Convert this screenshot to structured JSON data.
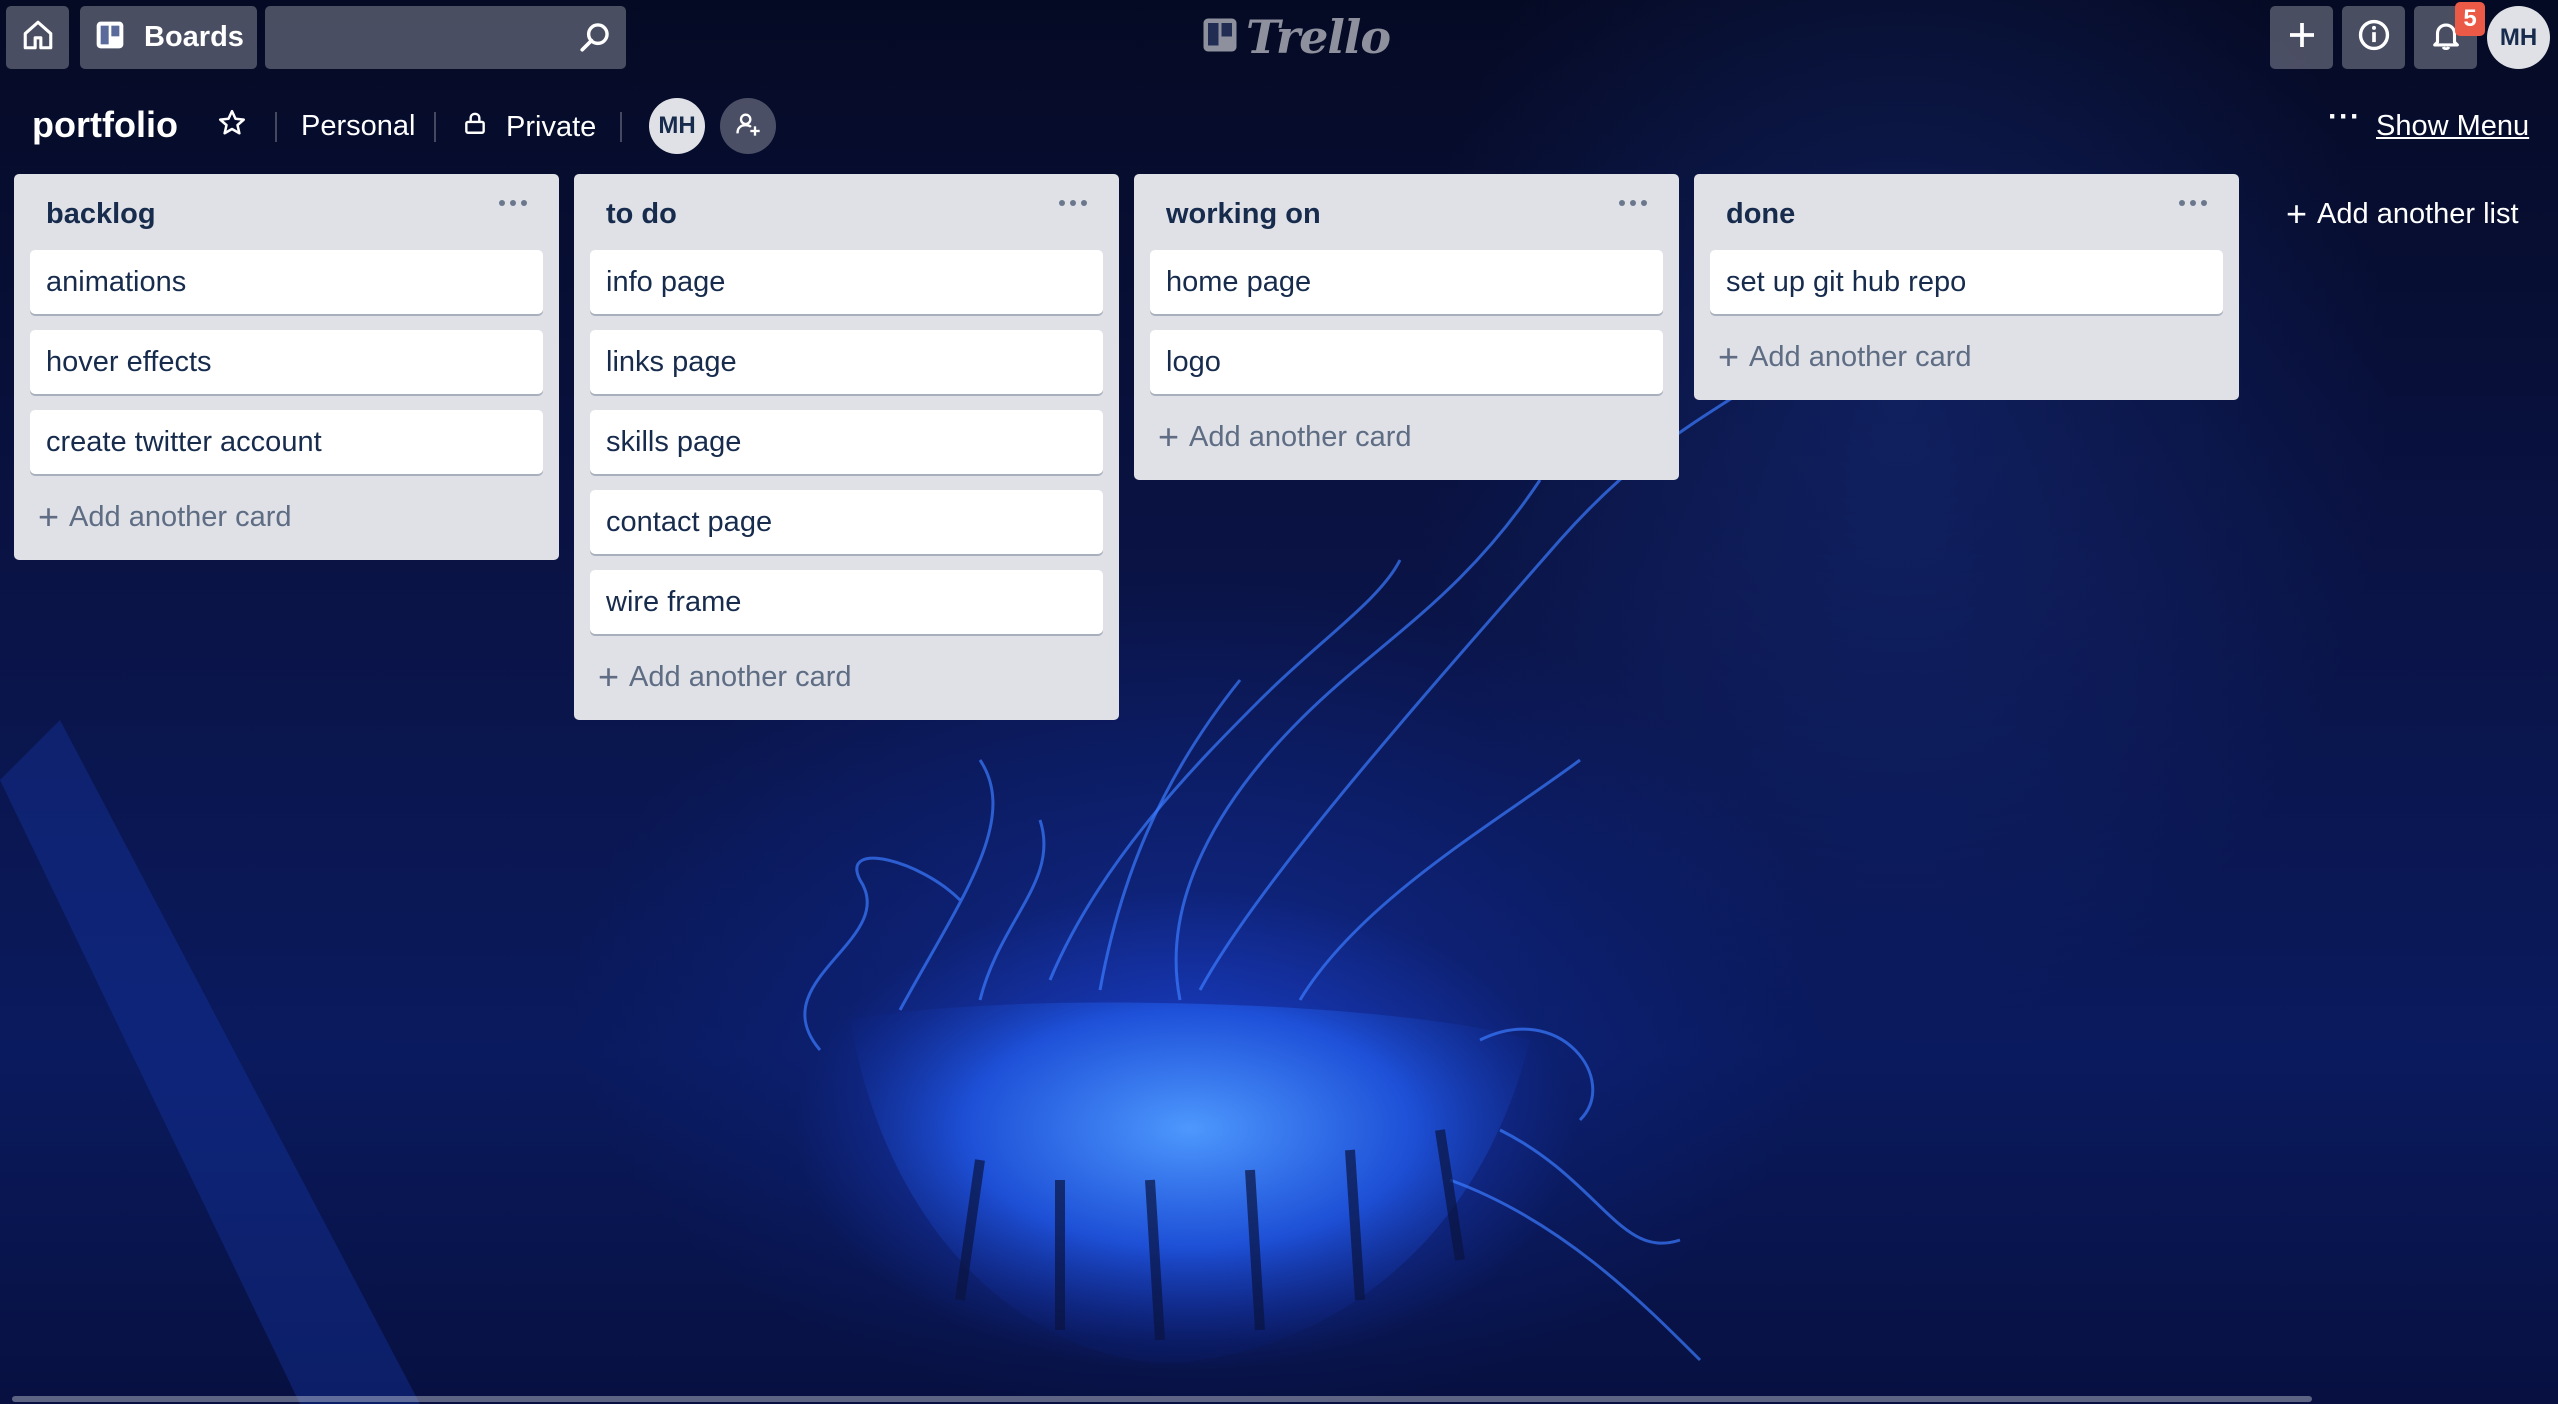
{
  "header": {
    "home_icon": "home-icon",
    "boards_label": "Boards",
    "search_placeholder": "",
    "logo_text": "Trello",
    "notification_count": "5",
    "user_initials": "MH"
  },
  "board": {
    "title": "portfolio",
    "team": "Personal",
    "visibility": "Private",
    "member_initials": "MH",
    "menu_dots": "···",
    "show_menu_label": "Show Menu"
  },
  "lists": [
    {
      "title": "backlog",
      "cards": [
        "animations",
        "hover effects",
        "create twitter account"
      ],
      "add_label": "Add another card"
    },
    {
      "title": "to do",
      "cards": [
        "info page",
        "links page",
        "skills page",
        "contact page",
        "wire frame"
      ],
      "add_label": "Add another card"
    },
    {
      "title": "working on",
      "cards": [
        "home page",
        "logo"
      ],
      "add_label": "Add another card"
    },
    {
      "title": "done",
      "cards": [
        "set up git hub repo"
      ],
      "add_label": "Add another card"
    }
  ],
  "add_list_label": "Add another list",
  "colors": {
    "list_bg": "#dfe1e6",
    "card_text": "#172b4d",
    "badge": "#eb5a46",
    "background": "#0a1448"
  }
}
